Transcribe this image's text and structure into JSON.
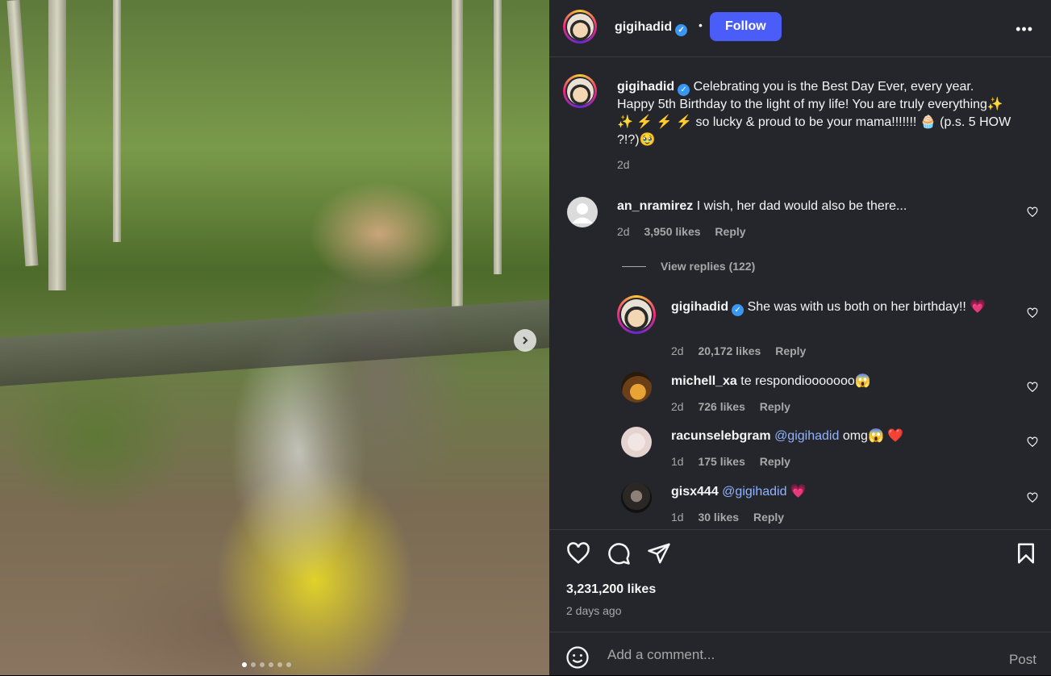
{
  "post": {
    "author": "gigihadid",
    "follow_label": "Follow",
    "more_label": "•••",
    "caption": {
      "author": "gigihadid",
      "text": "Celebrating you is the Best Day Ever, every year. Happy 5th Birthday to the light of my life! You are truly everything✨ ✨ ⚡ ⚡ ⚡ so lucky & proud to be your mama!!!!!!! 🧁 (p.s. 5 HOW ?!?)🥹",
      "time": "2d"
    },
    "likes": "3,231,200 likes",
    "posted_ago": "2 days ago",
    "carousel_dot_count": 6,
    "carousel_active_index": 0
  },
  "comments": [
    {
      "user": "an_nramirez",
      "text": "I wish, her dad would also be there...",
      "time": "2d",
      "likes": "3,950 likes",
      "reply": "Reply",
      "view_replies": "View replies (122)"
    },
    {
      "user": "gigihadid",
      "text": "She was with us both on her birthday!! 💗",
      "time": "2d",
      "likes": "20,172 likes",
      "reply": "Reply"
    },
    {
      "user": "michell_xa",
      "text": "te respondiooooooo😱",
      "time": "2d",
      "likes": "726 likes",
      "reply": "Reply"
    },
    {
      "user": "racunselebgram",
      "mention": "@gigihadid",
      "text": "omg😱 ❤️",
      "time": "1d",
      "likes": "175 likes",
      "reply": "Reply"
    },
    {
      "user": "gisx444",
      "mention": "@gigihadid",
      "text": "💗",
      "time": "1d",
      "likes": "30 likes",
      "reply": "Reply"
    }
  ],
  "comment_box": {
    "placeholder": "Add a comment...",
    "post_label": "Post"
  },
  "icons": [
    "heart-icon",
    "comment-icon",
    "share-icon",
    "bookmark-icon",
    "emoji-icon",
    "chevron-right-icon",
    "verified-icon",
    "more-icon"
  ]
}
